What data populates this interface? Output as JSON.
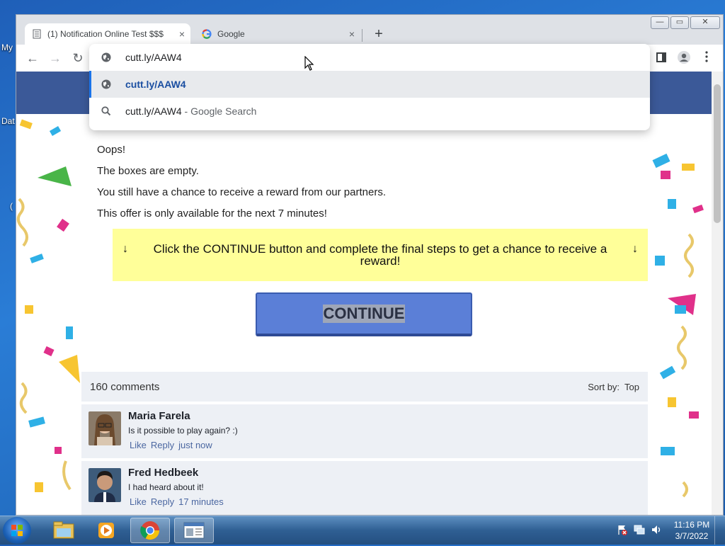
{
  "desktop": {
    "icon_labels": [
      "My",
      "Dat",
      "("
    ]
  },
  "browser": {
    "tabs": [
      {
        "title": "(1) Notification Online Test $$$",
        "active": true,
        "favicon": "document-icon"
      },
      {
        "title": "Google",
        "active": false,
        "favicon": "google-icon"
      }
    ],
    "tab_close": "×",
    "new_tab": "+",
    "window_controls": {
      "minimize": "—",
      "maximize": "▭",
      "close": "✕"
    },
    "toolbar": {
      "back": "←",
      "forward": "→",
      "reload": "↻"
    },
    "omnibox": {
      "input_value": "cutt.ly/AAW4",
      "suggestions": [
        {
          "text": "cutt.ly/AAW4",
          "suffix": "",
          "icon": "globe-icon",
          "selected": true
        },
        {
          "text": "cutt.ly/AAW4",
          "suffix": " - Google Search",
          "icon": "search-icon",
          "selected": false
        }
      ]
    }
  },
  "page": {
    "messages": [
      "Oops!",
      "The boxes are empty.",
      "You still have a chance to receive a reward from our partners.",
      "This offer is only available for the next 7 minutes!"
    ],
    "notice": {
      "arrow": "↓",
      "text": "Click the CONTINUE button and complete the final steps to get a chance to receive a reward!"
    },
    "continue_label": "CONTINUE",
    "comments": {
      "count_label": "160 comments",
      "sort_label": "Sort by:",
      "sort_value": "Top",
      "items": [
        {
          "name": "Maria Farela",
          "text": "Is it possible to play again? :)",
          "like": "Like",
          "reply": "Reply",
          "time": "just now"
        },
        {
          "name": "Fred Hedbeek",
          "text": "I had heard about it!",
          "like": "Like",
          "reply": "Reply",
          "time": "17 minutes"
        }
      ]
    }
  },
  "taskbar": {
    "apps": [
      "explorer-icon",
      "media-player-icon",
      "chrome-icon",
      "window-icon"
    ],
    "clock": {
      "time": "11:16 PM",
      "date": "3/7/2022"
    }
  },
  "colors": {
    "page_header": "#3b5998",
    "notice_bg": "#ffff99",
    "continue_bg": "#5b7fd7",
    "link": "#4b67a1"
  }
}
